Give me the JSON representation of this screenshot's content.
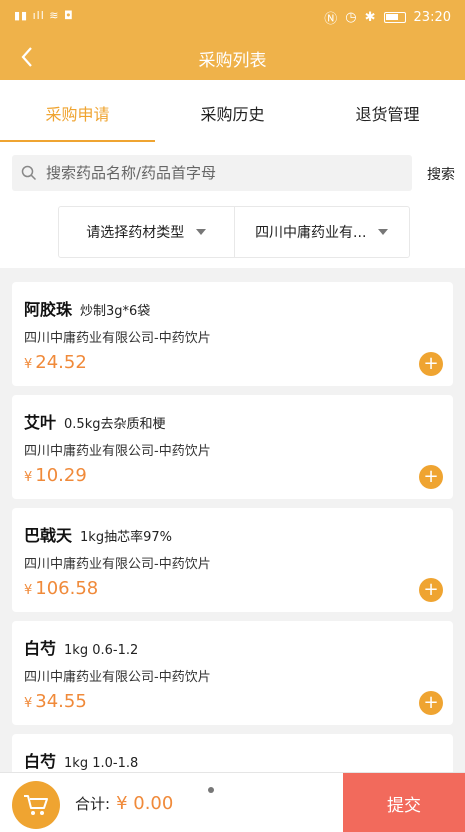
{
  "status_bar": {
    "time": "23:20"
  },
  "nav": {
    "title": "采购列表"
  },
  "tabs": [
    {
      "label": "采购申请",
      "active": true
    },
    {
      "label": "采购历史",
      "active": false
    },
    {
      "label": "退货管理",
      "active": false
    }
  ],
  "search": {
    "placeholder": "搜索药品名称/药品首字母",
    "button_label": "搜索"
  },
  "filters": {
    "type_label": "请选择药材类型",
    "supplier_label": "四川中庸药业有..."
  },
  "products": [
    {
      "name": "阿胶珠",
      "spec": "炒制3g*6袋",
      "supplier": "四川中庸药业有限公司-中药饮片",
      "currency": "¥",
      "price": "24.52"
    },
    {
      "name": "艾叶",
      "spec": "0.5kg去杂质和梗",
      "supplier": "四川中庸药业有限公司-中药饮片",
      "currency": "¥",
      "price": "10.29"
    },
    {
      "name": "巴戟天",
      "spec": "1kg抽芯率97%",
      "supplier": "四川中庸药业有限公司-中药饮片",
      "currency": "¥",
      "price": "106.58"
    },
    {
      "name": "白芍",
      "spec": "1kg 0.6-1.2",
      "supplier": "四川中庸药业有限公司-中药饮片",
      "currency": "¥",
      "price": "34.55"
    },
    {
      "name": "白芍",
      "spec": "1kg 1.0-1.8",
      "supplier": "",
      "currency": "",
      "price": ""
    }
  ],
  "footer": {
    "total_label": "合计:",
    "total_amount": "¥ 0.00",
    "submit_label": "提交"
  },
  "colors": {
    "accent": "#efa431",
    "price": "#f08a3a",
    "submit": "#f26a5c"
  }
}
